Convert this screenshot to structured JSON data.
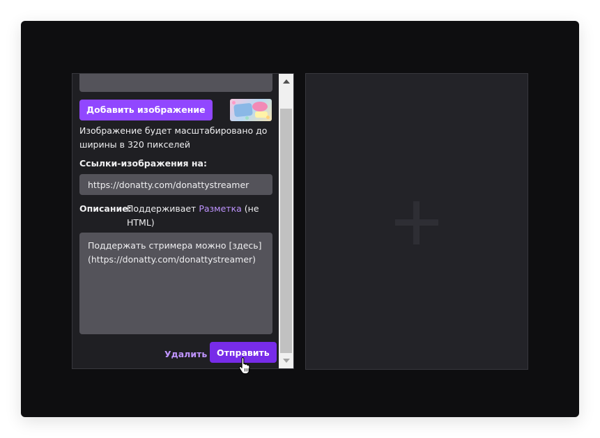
{
  "form": {
    "add_image_label": "Добавить изображение",
    "image_help": "Изображение будет масштабировано до ширины в 320 пикселей",
    "links_label": "Ссылки-изображения на:",
    "links_value": "https://donatty.com/donattystreamer",
    "description_label": "Описание:",
    "description_hint_prefix": "Поддерживает ",
    "description_hint_link": "Разметка",
    "description_hint_suffix": " (не HTML)",
    "description_value": "Поддержать стримера можно [здесь] (https://donatty.com/donattystreamer)",
    "delete_label": "Удалить",
    "submit_label": "Отправить"
  },
  "icons": {
    "add_panel": "plus-icon",
    "cursor": "hand-pointer-icon",
    "scroll_up": "arrow-up-icon",
    "scroll_down": "arrow-down-icon"
  },
  "colors": {
    "accent": "#9147ff",
    "accent_dark": "#772ce8",
    "link": "#bf94ff",
    "background": "#0e0e10",
    "panel": "#1f1f23",
    "input": "#54535a"
  }
}
